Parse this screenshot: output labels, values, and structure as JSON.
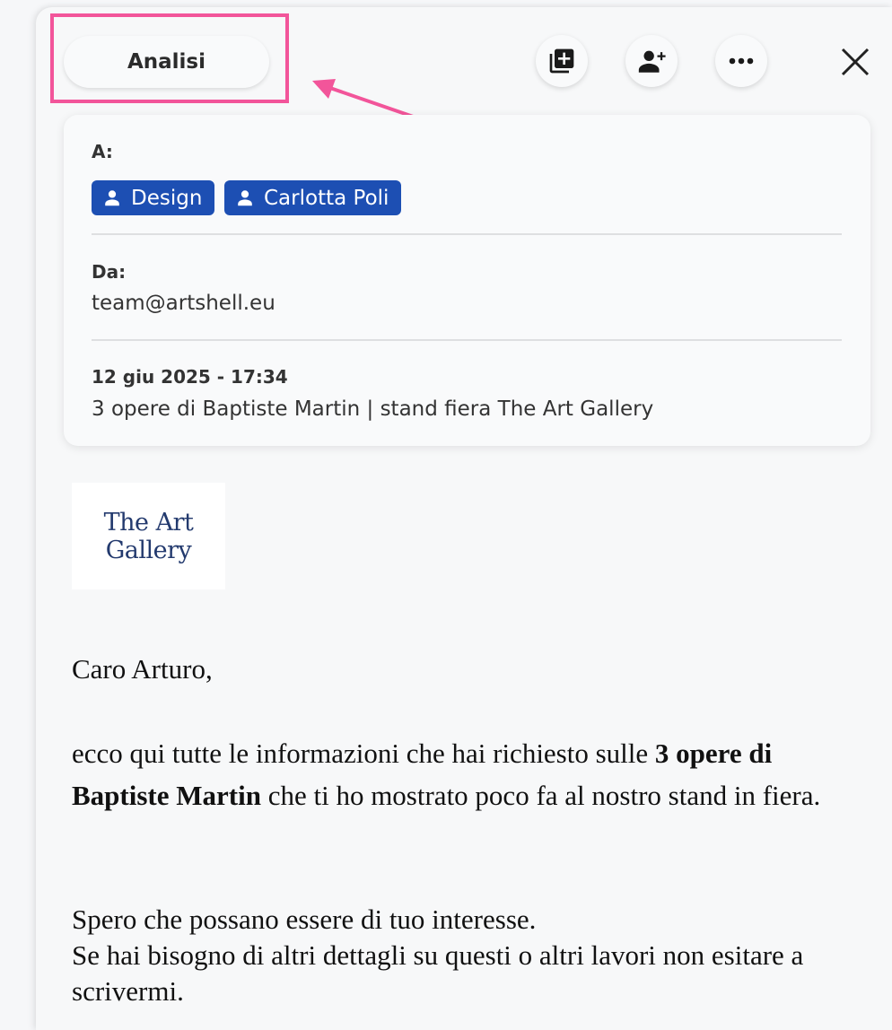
{
  "toolbar": {
    "tab_label": "Analisi",
    "actions": [
      {
        "name": "add-note-button",
        "icon": "library-add-icon"
      },
      {
        "name": "add-person-button",
        "icon": "person-add-icon"
      },
      {
        "name": "more-options-button",
        "icon": "more-horizontal-icon"
      }
    ],
    "close_icon": "close-icon"
  },
  "header": {
    "to_label": "A:",
    "recipients": [
      {
        "label": "Design",
        "icon": "person-icon"
      },
      {
        "label": "Carlotta Poli",
        "icon": "person-icon"
      }
    ],
    "from_label": "Da:",
    "from_value": "team@artshell.eu",
    "date": "12 giu 2025 - 17:34",
    "subject": "3 opere di Baptiste Martin | stand fiera The Art Gallery"
  },
  "body": {
    "logo_line1": "The Art",
    "logo_line2": "Gallery",
    "greeting": "Caro Arturo,",
    "para1_before": "ecco qui tutte le informazioni che hai richiesto sulle ",
    "para1_bold": "3 opere di Baptiste Martin",
    "para1_after": " che ti ho mostrato poco fa al nostro stand in fiera.",
    "para2_line1": "Spero che possano essere di tuo interesse.",
    "para2_line2": "Se hai bisogno di altri dettagli su questi o altri lavori non esitare a scrivermi."
  },
  "colors": {
    "accent": "#1d4fb3",
    "highlight": "#f2559a",
    "logo_text": "#233a6e"
  }
}
